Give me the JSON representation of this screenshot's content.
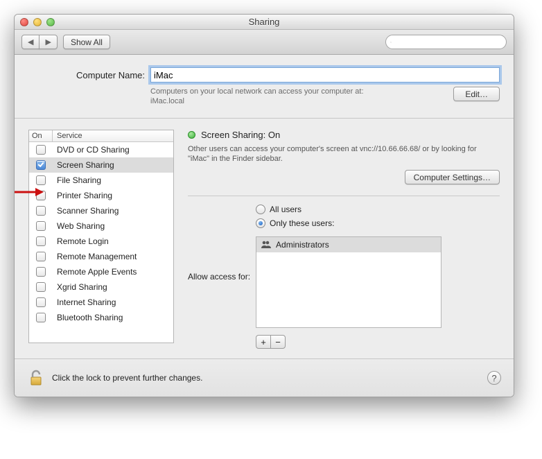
{
  "window_title": "Sharing",
  "toolbar": {
    "show_all": "Show All"
  },
  "search": {
    "placeholder": ""
  },
  "computer_name_label": "Computer Name:",
  "computer_name_value": "iMac",
  "hint_line1": "Computers on your local network can access your computer at:",
  "hint_line2": "iMac.local",
  "edit_button": "Edit…",
  "services_header_on": "On",
  "services_header_service": "Service",
  "services": [
    {
      "label": "DVD or CD Sharing",
      "on": false,
      "selected": false
    },
    {
      "label": "Screen Sharing",
      "on": true,
      "selected": true
    },
    {
      "label": "File Sharing",
      "on": false,
      "selected": false
    },
    {
      "label": "Printer Sharing",
      "on": false,
      "selected": false
    },
    {
      "label": "Scanner Sharing",
      "on": false,
      "selected": false
    },
    {
      "label": "Web Sharing",
      "on": false,
      "selected": false
    },
    {
      "label": "Remote Login",
      "on": false,
      "selected": false
    },
    {
      "label": "Remote Management",
      "on": false,
      "selected": false
    },
    {
      "label": "Remote Apple Events",
      "on": false,
      "selected": false
    },
    {
      "label": "Xgrid Sharing",
      "on": false,
      "selected": false
    },
    {
      "label": "Internet Sharing",
      "on": false,
      "selected": false
    },
    {
      "label": "Bluetooth Sharing",
      "on": false,
      "selected": false
    }
  ],
  "status_title": "Screen Sharing: On",
  "status_desc": "Other users can access your computer's screen at vnc://10.66.66.68/ or by looking for \"iMac\" in the Finder sidebar.",
  "computer_settings_button": "Computer Settings…",
  "access_label": "Allow access for:",
  "access_all": "All users",
  "access_only": "Only these users:",
  "access_mode": "only",
  "users": [
    {
      "label": "Administrators"
    }
  ],
  "lock_hint": "Click the lock to prevent further changes."
}
